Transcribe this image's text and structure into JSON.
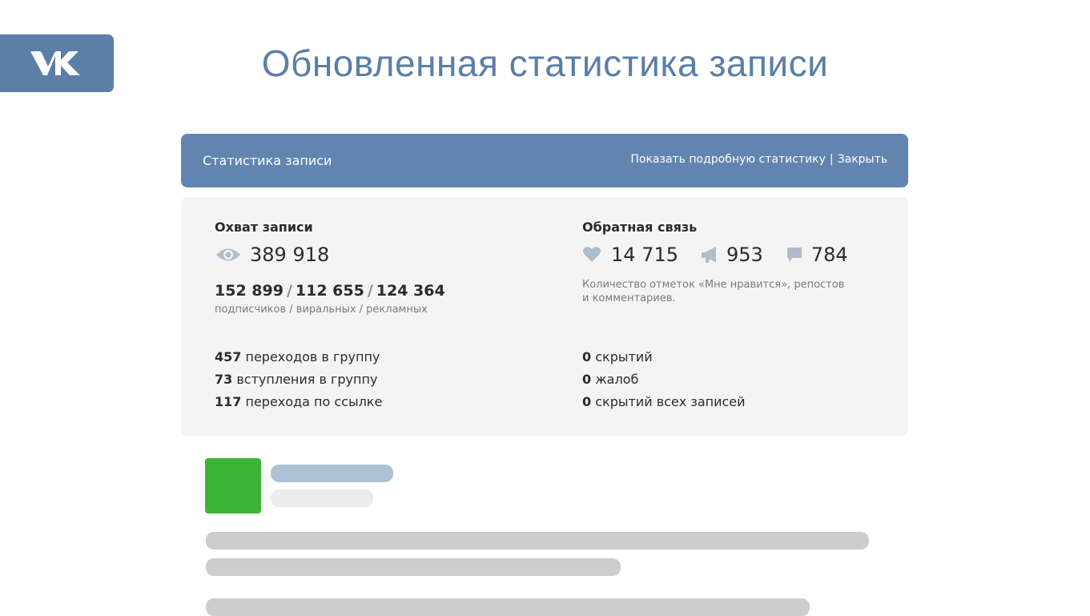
{
  "slide": {
    "title": "Обновленная статистика записи"
  },
  "brand": {
    "logo_icon": "vk-logo-icon",
    "accent_color": "#5b7fa6"
  },
  "stats_panel": {
    "title": "Статистика записи",
    "show_details_link": "Показать подробную статистику",
    "separator": "|",
    "close_link": "Закрыть",
    "reach": {
      "title": "Охват записи",
      "icon": "eye-icon",
      "total": "389 918",
      "subscribers": "152 899",
      "viral": "112 655",
      "ads": "124 364",
      "slash": "/",
      "breakdown_caption": "подписчиков / виральных / рекламных",
      "transitions_count": "457",
      "transitions_label": "переходов в группу",
      "joins_count": "73",
      "joins_label": "вступления в группу",
      "link_clicks_count": "117",
      "link_clicks_label": "перехода по ссылке"
    },
    "feedback": {
      "title": "Обратная связь",
      "likes": "14 715",
      "reposts": "953",
      "comments": "784",
      "caption_line1": "Количество отметок «Мне нравится», репостов",
      "caption_line2": "и комментариев.",
      "hidden_count": "0",
      "hidden_label": "скрытий",
      "complaints_count": "0",
      "complaints_label": "жалоб",
      "hide_all_count": "0",
      "hide_all_label": "скрытий всех записей"
    }
  },
  "post_placeholder": {
    "avatar_color": "#3db335"
  }
}
